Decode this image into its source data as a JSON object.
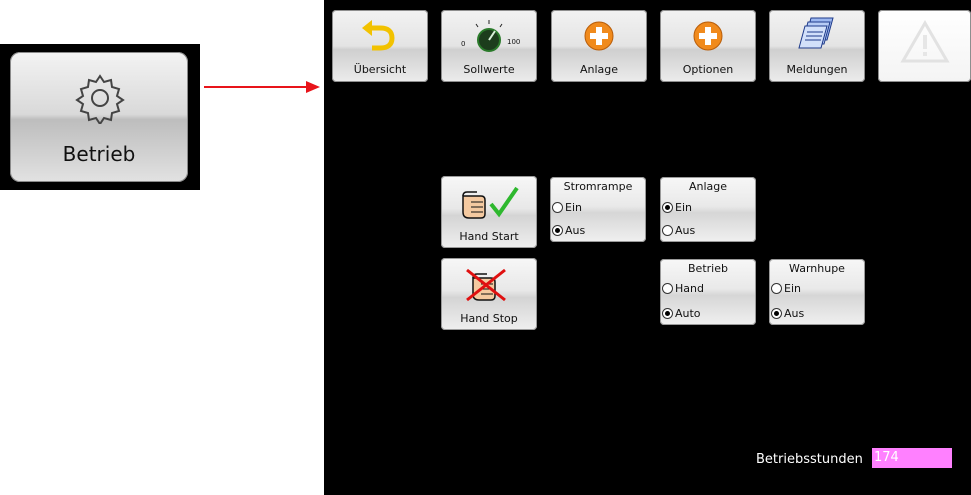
{
  "callout": {
    "label": "Betrieb",
    "icon": "gear-icon"
  },
  "toolbar": {
    "items": [
      {
        "label": "Übersicht",
        "icon": "back-arrow-icon"
      },
      {
        "label": "Sollwerte",
        "icon": "dial-knob-icon",
        "scale_min": "0",
        "scale_max": "100"
      },
      {
        "label": "Anlage",
        "icon": "plus-circle-icon"
      },
      {
        "label": "Optionen",
        "icon": "plus-circle-icon"
      },
      {
        "label": "Meldungen",
        "icon": "documents-icon"
      },
      {
        "label": "",
        "icon": "warning-icon"
      }
    ]
  },
  "controls": {
    "hand_start": {
      "label": "Hand Start",
      "icon": "hand-check-icon"
    },
    "hand_stop": {
      "label": "Hand Stop",
      "icon": "hand-cross-icon"
    },
    "stromrampe": {
      "title": "Stromrampe",
      "options": [
        "Ein",
        "Aus"
      ],
      "selected": "Aus"
    },
    "anlage": {
      "title": "Anlage",
      "options": [
        "Ein",
        "Aus"
      ],
      "selected": "Ein"
    },
    "betrieb": {
      "title": "Betrieb",
      "options": [
        "Hand",
        "Auto"
      ],
      "selected": "Auto"
    },
    "warnhupe": {
      "title": "Warnhupe",
      "options": [
        "Ein",
        "Aus"
      ],
      "selected": "Aus"
    }
  },
  "status": {
    "hours_label": "Betriebsstunden",
    "hours_value": "174"
  },
  "colors": {
    "screen_bg": "#000000",
    "hours_field_bg": "#ff80ff",
    "arrow": "#e8141a",
    "accent_orange": "#f08a1c",
    "check_green": "#2eb82e",
    "cross_red": "#e01010"
  }
}
